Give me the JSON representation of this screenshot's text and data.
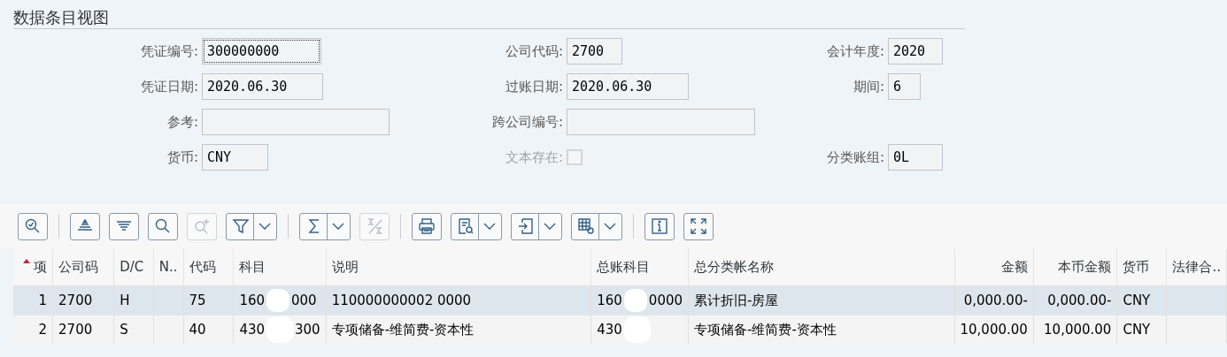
{
  "title": "数据条目视图",
  "form": {
    "rows": [
      [
        {
          "label": "凭证编号:",
          "value": "300000000",
          "focused": true
        },
        {
          "label": "公司代码:",
          "value": "2700"
        },
        {
          "label": "会计年度:",
          "value": "2020"
        }
      ],
      [
        {
          "label": "凭证日期:",
          "value": "2020.06.30"
        },
        {
          "label": "过账日期:",
          "value": "2020.06.30"
        },
        {
          "label": "期间:",
          "value": "6"
        }
      ],
      [
        {
          "label": "参考:"
        },
        {
          "label": "跨公司编号:"
        },
        null
      ],
      [
        {
          "label": "货币:",
          "value": "CNY"
        },
        {
          "label": "文本存在:",
          "kind": "checkbox",
          "checked": false,
          "disabled": true
        },
        {
          "label": "分类账组:",
          "value": "0L"
        }
      ]
    ]
  },
  "toolbar": [
    {
      "kind": "button",
      "disabled": false,
      "dropdown": false
    },
    {
      "kind": "separator"
    },
    {
      "kind": "button",
      "disabled": false,
      "dropdown": false
    },
    {
      "kind": "button",
      "disabled": false,
      "dropdown": false
    },
    {
      "kind": "button",
      "disabled": false,
      "dropdown": false
    },
    {
      "kind": "button",
      "disabled": true,
      "dropdown": false
    },
    {
      "kind": "button",
      "disabled": false,
      "dropdown": true
    },
    {
      "kind": "separator"
    },
    {
      "kind": "button",
      "disabled": false,
      "dropdown": true
    },
    {
      "kind": "button",
      "disabled": true,
      "dropdown": false
    },
    {
      "kind": "separator"
    },
    {
      "kind": "button",
      "disabled": false,
      "dropdown": false
    },
    {
      "kind": "button",
      "disabled": false,
      "dropdown": true
    },
    {
      "kind": "button",
      "disabled": false,
      "dropdown": true
    },
    {
      "kind": "button",
      "disabled": false,
      "dropdown": true
    },
    {
      "kind": "separator"
    },
    {
      "kind": "button",
      "disabled": false,
      "dropdown": false
    },
    {
      "kind": "button",
      "disabled": false,
      "dropdown": false
    }
  ],
  "table": {
    "columns": [
      {
        "label": "项",
        "sorted": true
      },
      {
        "label": "公司码",
        "sorted": false
      },
      {
        "label": "D/C",
        "sorted": false
      },
      {
        "label": "N..",
        "sorted": false
      },
      {
        "label": "代码",
        "sorted": false
      },
      {
        "label": "科目",
        "sorted": false
      },
      {
        "label": "说明",
        "sorted": false
      },
      {
        "label": "总账科目",
        "sorted": false
      },
      {
        "label": "总分类帐名称",
        "sorted": false
      },
      {
        "label": "金额",
        "sorted": false
      },
      {
        "label": "本币金额",
        "sorted": false
      },
      {
        "label": "货币",
        "sorted": false
      },
      {
        "label": "法律合..",
        "sorted": false
      }
    ],
    "rows": [
      {
        "selected": true,
        "cells": [
          {
            "text": "1"
          },
          {
            "text": "2700"
          },
          {
            "text": "H"
          },
          {},
          {
            "text": "75"
          },
          {
            "text": "160",
            "redacted": true,
            "suffix": "000"
          },
          {
            "text": "110000000002 0000"
          },
          {
            "text": "160",
            "redacted": true,
            "suffix": "0000"
          },
          {
            "text": "累计折旧-房屋"
          },
          {
            "text": "0,000.00-"
          },
          {
            "text": "0,000.00-"
          },
          {
            "text": "CNY"
          },
          {}
        ]
      },
      {
        "selected": false,
        "cells": [
          {
            "text": "2"
          },
          {
            "text": "2700"
          },
          {
            "text": "S"
          },
          {},
          {
            "text": "40"
          },
          {
            "text": "430",
            "redacted": true,
            "suffix": "300"
          },
          {
            "text": "专项储备-维简费-资本性"
          },
          {
            "text": "430",
            "redacted": true
          },
          {
            "text": "专项储备-维简费-资本性"
          },
          {
            "text": "10,000.00"
          },
          {
            "text": "10,000.00"
          },
          {
            "text": "CNY"
          },
          {}
        ]
      }
    ]
  }
}
